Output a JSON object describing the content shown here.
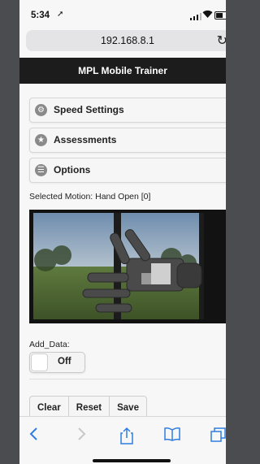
{
  "status_bar": {
    "time": "5:34",
    "location_glyph": "➚"
  },
  "browser": {
    "url": "192.168.8.1",
    "reload_glyph": "↻"
  },
  "app": {
    "title": "MPL Mobile Trainer"
  },
  "sections": [
    {
      "icon": "gear-icon",
      "glyph": "⚙",
      "label": "Speed Settings"
    },
    {
      "icon": "star-icon",
      "glyph": "★",
      "label": "Assessments"
    },
    {
      "icon": "list-icon",
      "glyph": "☰",
      "label": "Options"
    }
  ],
  "motion": {
    "text": "Selected Motion: Hand Open [0]"
  },
  "add_data": {
    "label": "Add_Data:",
    "state": "Off"
  },
  "actions": {
    "clear": "Clear",
    "reset": "Reset",
    "save": "Save"
  },
  "toolbar": {
    "back_icon": "chevron-left-icon",
    "forward_icon": "chevron-right-icon",
    "share_icon": "share-icon",
    "bookmarks_icon": "book-icon",
    "tabs_icon": "tabs-icon"
  },
  "colors": {
    "header_bg": "#1c1c1c",
    "accent": "#2f7de1"
  }
}
